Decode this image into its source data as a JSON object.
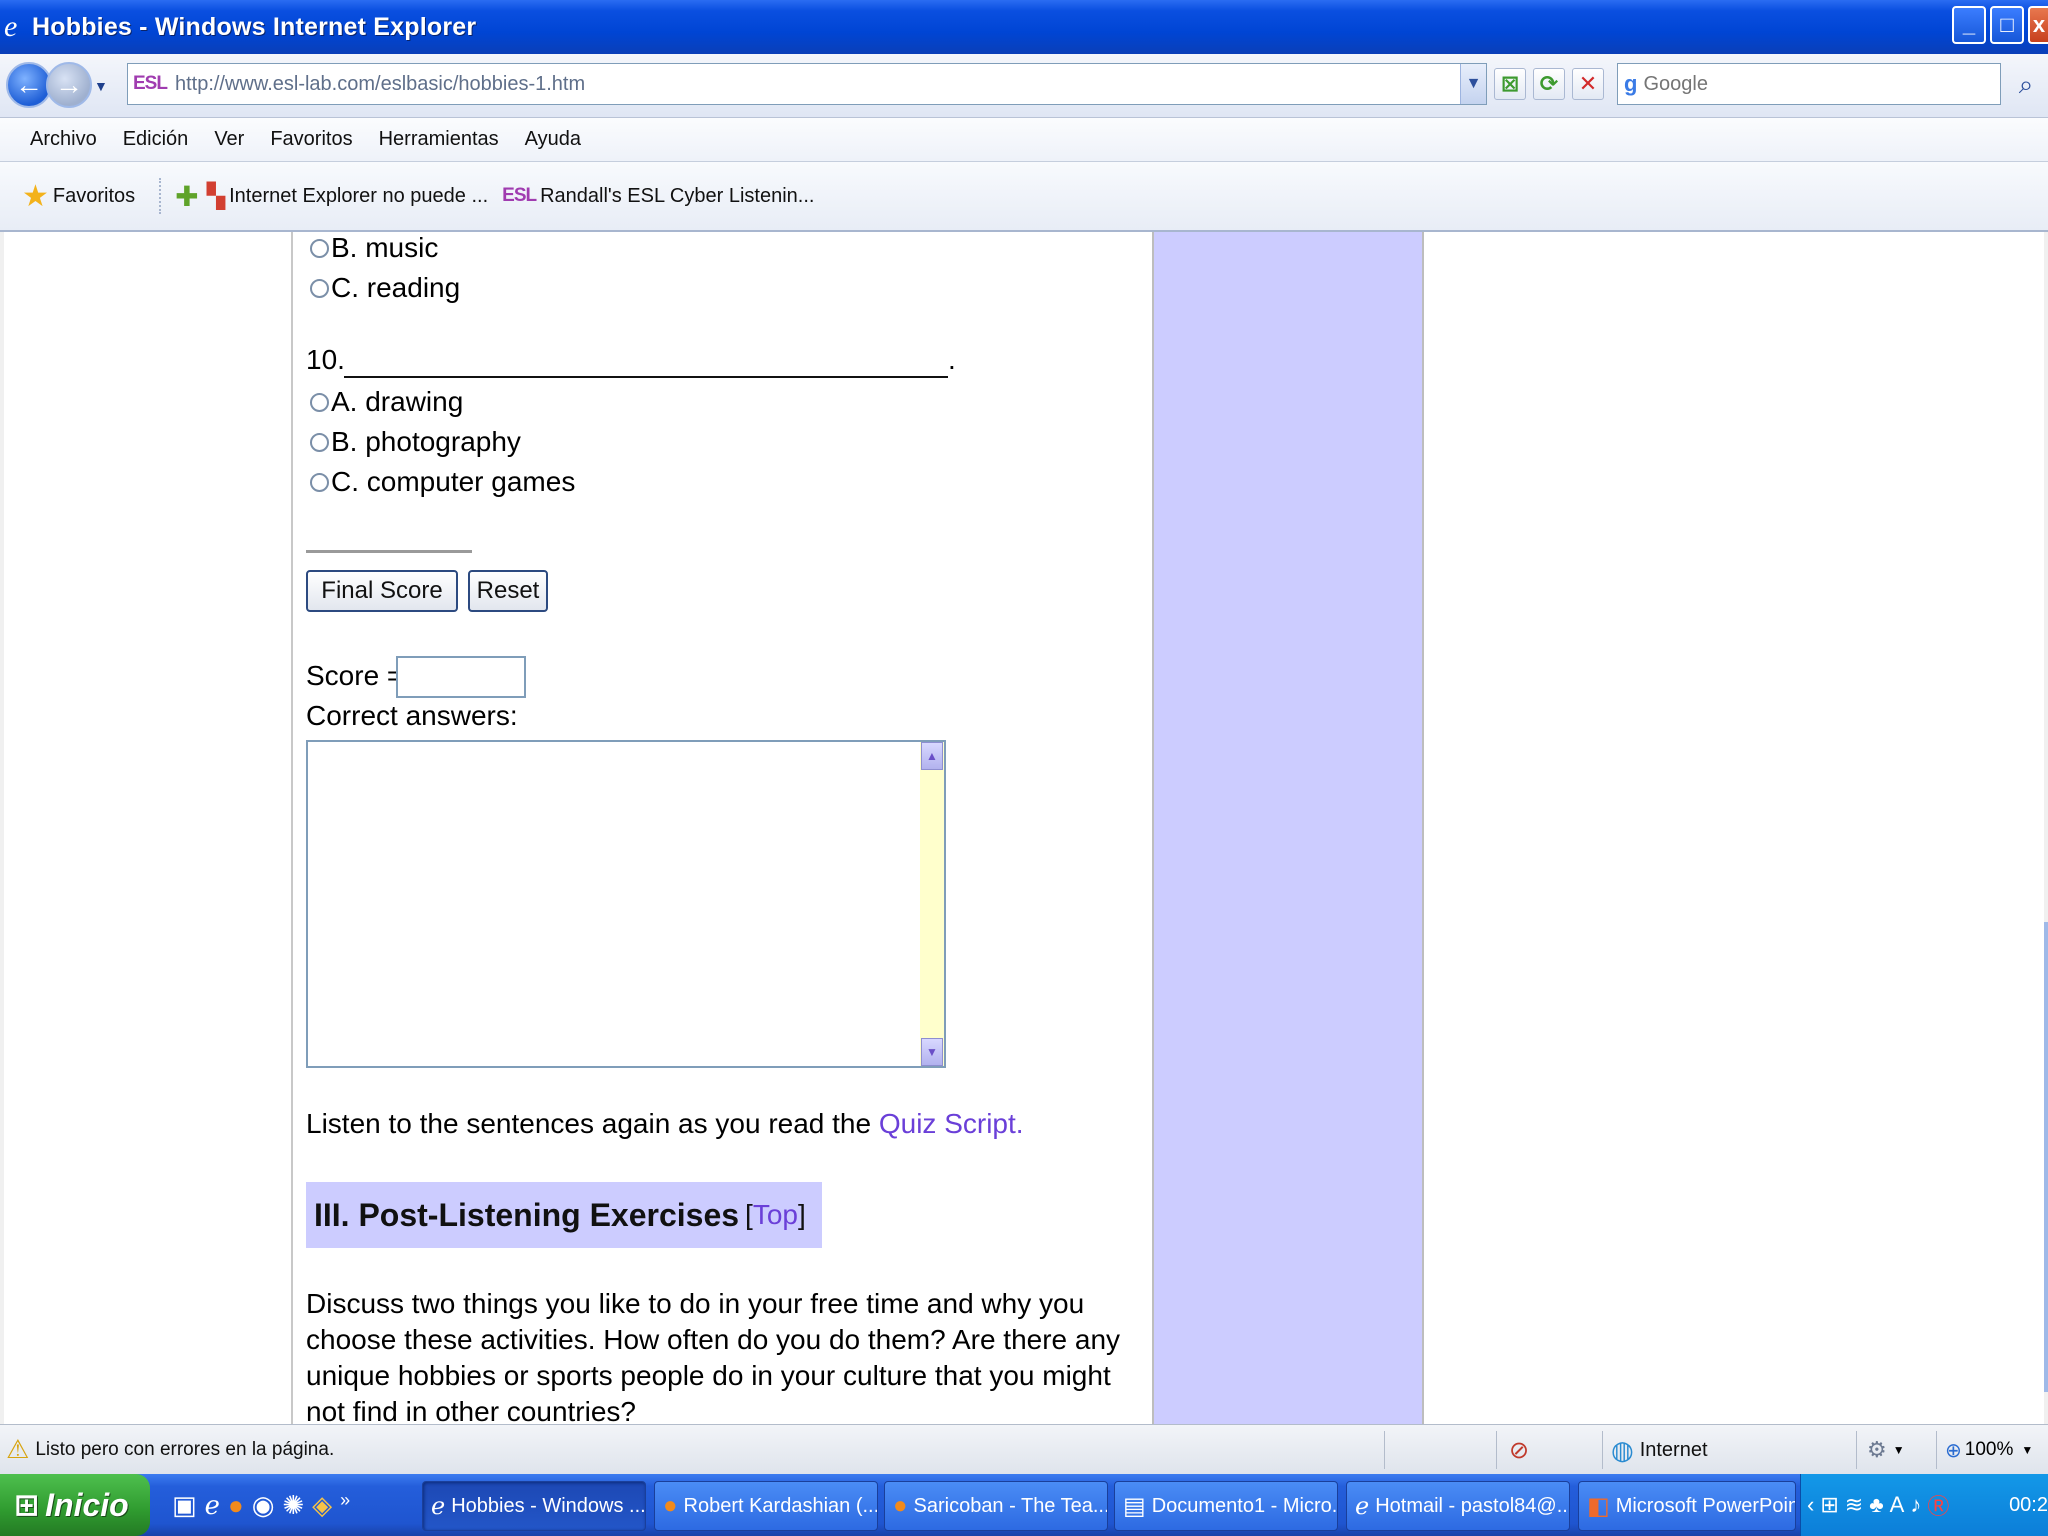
{
  "window": {
    "title": "Hobbies - Windows Internet Explorer",
    "controls": [
      "_",
      "□",
      "x"
    ]
  },
  "navigation": {
    "address_badge": "ESL",
    "url": "http://www.esl-lab.com/eslbasic/hobbies-1.htm",
    "search_placeholder": "Google",
    "search_badge": "g"
  },
  "menu": {
    "items": [
      "Archivo",
      "Edición",
      "Ver",
      "Favoritos",
      "Herramientas",
      "Ayuda"
    ]
  },
  "favorites_bar": {
    "label": "Favoritos",
    "items": [
      {
        "label": "Internet Explorer no puede ..."
      },
      {
        "label": "Randall's ESL Cyber Listenin..."
      }
    ],
    "esl_badge": "ESL"
  },
  "page": {
    "q9_options": [
      "B. music",
      "C. reading"
    ],
    "q10": {
      "number": "10.",
      "trailing": ".",
      "options": [
        "A. drawing",
        "B. photography",
        "C. computer games"
      ]
    },
    "buttons": {
      "final_score": "Final Score",
      "reset": "Reset"
    },
    "score_label": "Score =",
    "correct_answers_label": "Correct answers:",
    "listen_prefix": "Listen to the sentences again as you read the ",
    "quiz_script_link": "Quiz Script.",
    "section_heading": "III. Post-Listening Exercises",
    "top_link": "Top",
    "top_open": "[",
    "top_close": "]",
    "discussion": "Discuss two things you like to do in your free time and why you choose these activities. How often do you do them? Are there any unique hobbies or sports people do in your culture that you might not find in other countries?"
  },
  "status_bar": {
    "message": "Listo pero con errores en la página.",
    "zone": "Internet",
    "zoom": "100%"
  },
  "taskbar": {
    "start_label": "Inicio",
    "tasks": [
      {
        "label": "Hobbies - Windows ...",
        "active": true
      },
      {
        "label": "Robert Kardashian (...",
        "active": false
      },
      {
        "label": "Saricoban - The Tea...",
        "active": false
      },
      {
        "label": "Documento1 - Micro...",
        "active": false
      },
      {
        "label": "Hotmail - pastol84@...",
        "active": false
      },
      {
        "label": "Microsoft PowerPoin...",
        "active": false
      }
    ],
    "clock": "00:2"
  },
  "colors": {
    "sidebar": "#ccccff",
    "link": "#6a3fd8",
    "section_bg": "#ccccff",
    "textarea_scroll": "#ffffcc"
  }
}
